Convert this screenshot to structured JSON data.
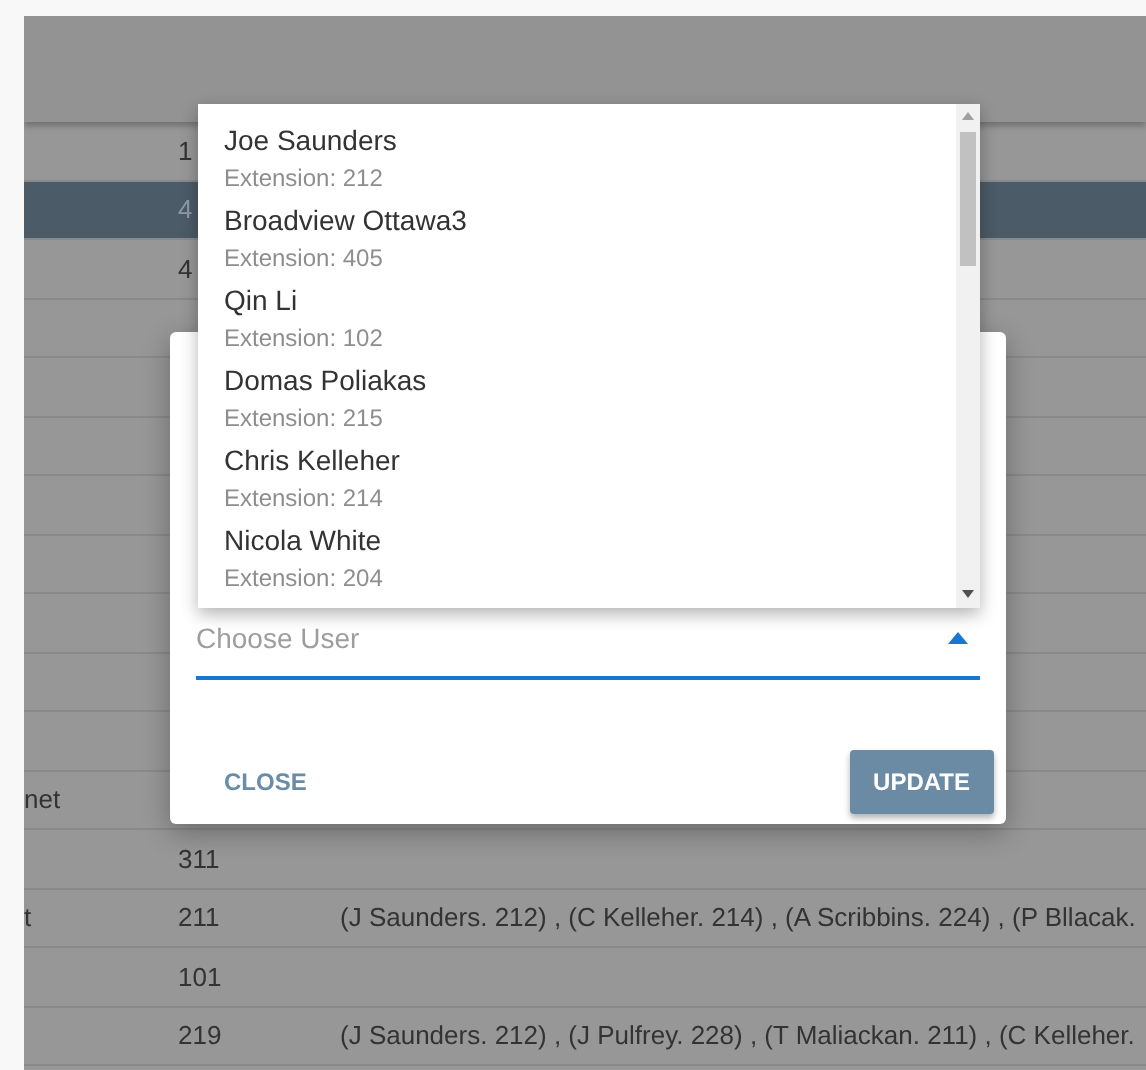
{
  "table": {
    "rows": [
      {
        "selected": false,
        "column_2": "1"
      },
      {
        "selected": true,
        "column_2": "4"
      },
      {
        "selected": false,
        "column_2": "4"
      },
      {
        "selected": false
      },
      {
        "selected": false
      },
      {
        "selected": false
      },
      {
        "selected": false
      },
      {
        "selected": false
      },
      {
        "selected": false
      },
      {
        "selected": false
      },
      {
        "selected": false
      },
      {
        "selected": false,
        "column_1": "net"
      },
      {
        "selected": false,
        "column_2": "311"
      },
      {
        "selected": false,
        "column_1": "t",
        "column_2": "211",
        "column_3": "(J Saunders. 212) , (C Kelleher. 214) , (A Scribbins. 224) , (P Bllacak."
      },
      {
        "selected": false,
        "column_2": "101"
      },
      {
        "selected": false,
        "column_2": "219",
        "column_3": "(J Saunders. 212) , (J Pulfrey. 228) , (T Maliackan. 211) , (C Kelleher."
      }
    ]
  },
  "dialog": {
    "user_field": {
      "placeholder": "Choose User",
      "expanded": true
    },
    "buttons": [
      {
        "label": "CLOSE",
        "kind": "text"
      },
      {
        "label": "UPDATE",
        "kind": "raised"
      }
    ]
  },
  "dropdown": {
    "options": [
      {
        "name": "Joe Saunders",
        "extension": "Extension: 212"
      },
      {
        "name": "Broadview Ottawa3",
        "extension": "Extension: 405"
      },
      {
        "name": "Qin Li",
        "extension": "Extension: 102"
      },
      {
        "name": "Domas Poliakas",
        "extension": "Extension: 215"
      },
      {
        "name": "Chris Kelleher",
        "extension": "Extension: 214"
      },
      {
        "name": "Nicola White",
        "extension": "Extension: 204"
      }
    ]
  }
}
